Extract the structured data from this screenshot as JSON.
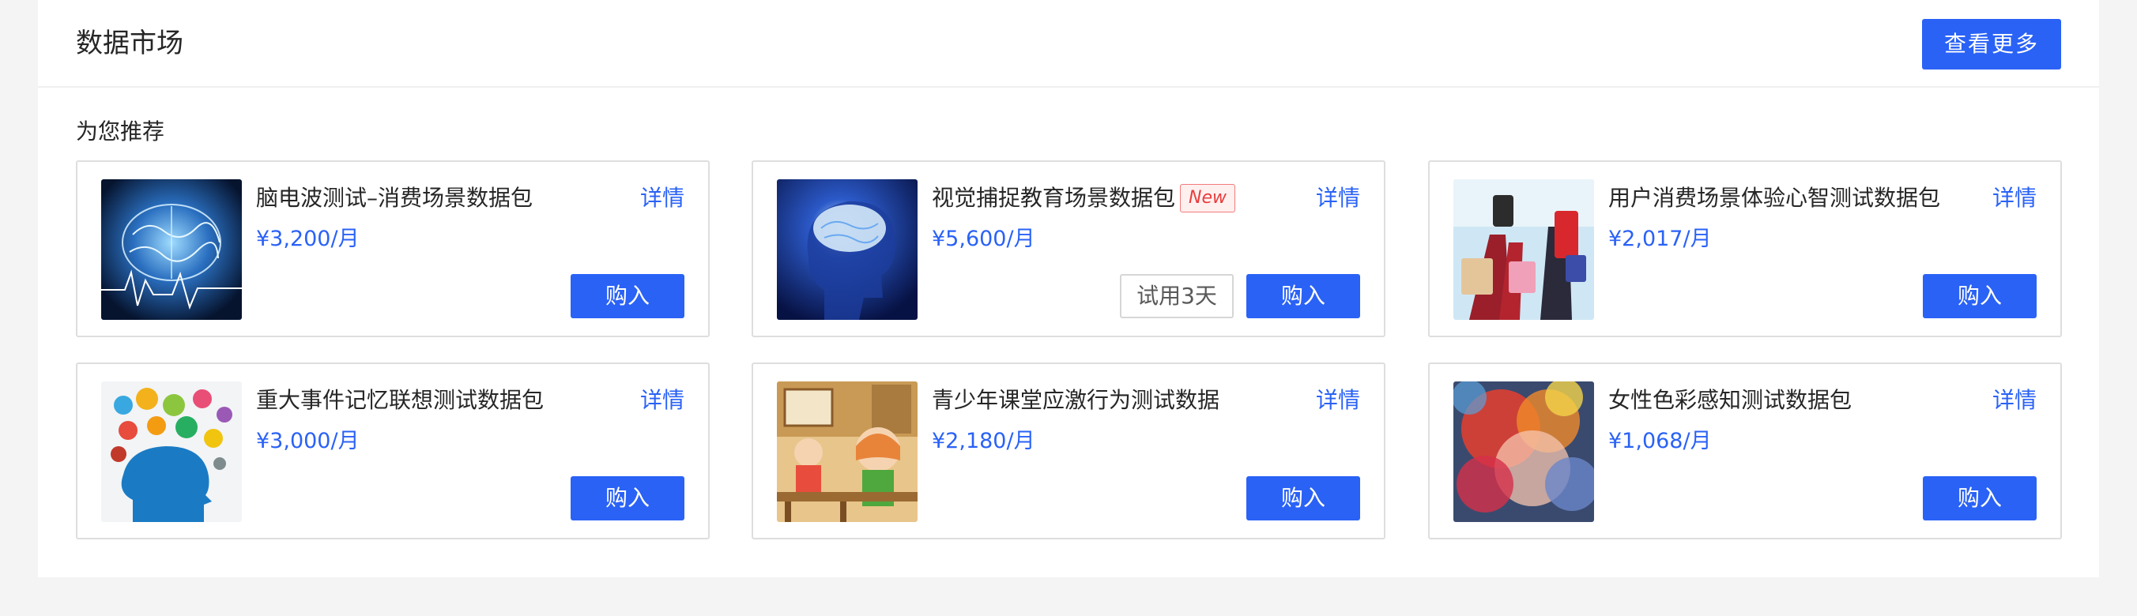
{
  "header": {
    "title": "数据市场",
    "more_label": "查看更多"
  },
  "section": {
    "title": "为您推荐"
  },
  "colors": {
    "accent": "#2a62f6",
    "badge_red": "#e83d3d",
    "card_border": "#dedede"
  },
  "cards": [
    {
      "name": "脑电波测试–消费场景数据包",
      "price": "¥3,200/月",
      "detail": "详情",
      "buy": "购入",
      "image": "brain-waves-image"
    },
    {
      "name": "视觉捕捉教育场景数据包",
      "badge": "New",
      "price": "¥5,600/月",
      "detail": "详情",
      "trial": "试用3天",
      "buy": "购入",
      "image": "glowing-brain-head-image"
    },
    {
      "name": "用户消费场景体验心智测试数据包",
      "price": "¥2,017/月",
      "detail": "详情",
      "buy": "购入",
      "image": "shopping-women-image"
    },
    {
      "name": "重大事件记忆联想测试数据包",
      "price": "¥3,000/月",
      "detail": "详情",
      "buy": "购入",
      "image": "head-icons-image"
    },
    {
      "name": "青少年课堂应激行为测试数据",
      "price": "¥2,180/月",
      "detail": "详情",
      "buy": "购入",
      "image": "classroom-cartoon-image"
    },
    {
      "name": "女性色彩感知测试数据包",
      "price": "¥1,068/月",
      "detail": "详情",
      "buy": "购入",
      "image": "color-explosion-image"
    }
  ]
}
